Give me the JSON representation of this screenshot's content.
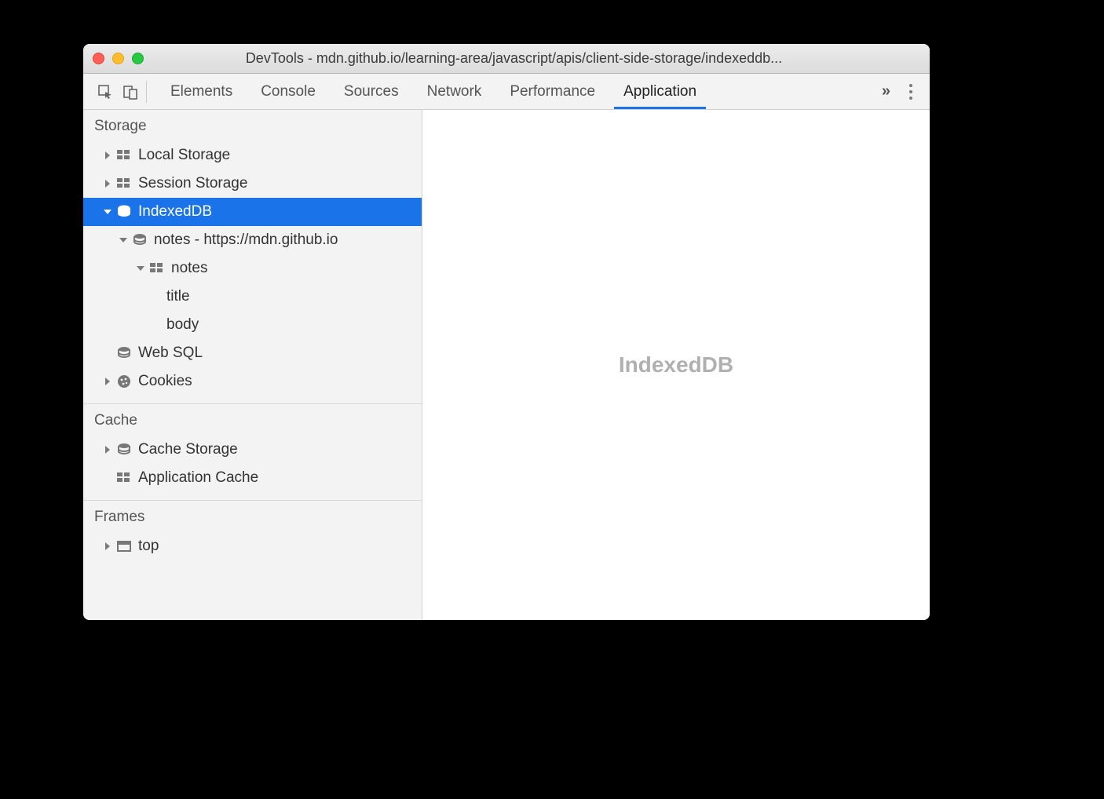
{
  "window": {
    "title": "DevTools - mdn.github.io/learning-area/javascript/apis/client-side-storage/indexeddb..."
  },
  "tabs": {
    "items": [
      {
        "label": "Elements",
        "active": false
      },
      {
        "label": "Console",
        "active": false
      },
      {
        "label": "Sources",
        "active": false
      },
      {
        "label": "Network",
        "active": false
      },
      {
        "label": "Performance",
        "active": false
      },
      {
        "label": "Application",
        "active": true
      }
    ]
  },
  "sidebar": {
    "sections": {
      "storage": {
        "title": "Storage",
        "local_storage": "Local Storage",
        "session_storage": "Session Storage",
        "indexeddb": "IndexedDB",
        "idb_db": "notes - https://mdn.github.io",
        "idb_store": "notes",
        "idx_title": "title",
        "idx_body": "body",
        "web_sql": "Web SQL",
        "cookies": "Cookies"
      },
      "cache": {
        "title": "Cache",
        "cache_storage": "Cache Storage",
        "application_cache": "Application Cache"
      },
      "frames": {
        "title": "Frames",
        "top": "top"
      }
    }
  },
  "main": {
    "heading": "IndexedDB"
  }
}
